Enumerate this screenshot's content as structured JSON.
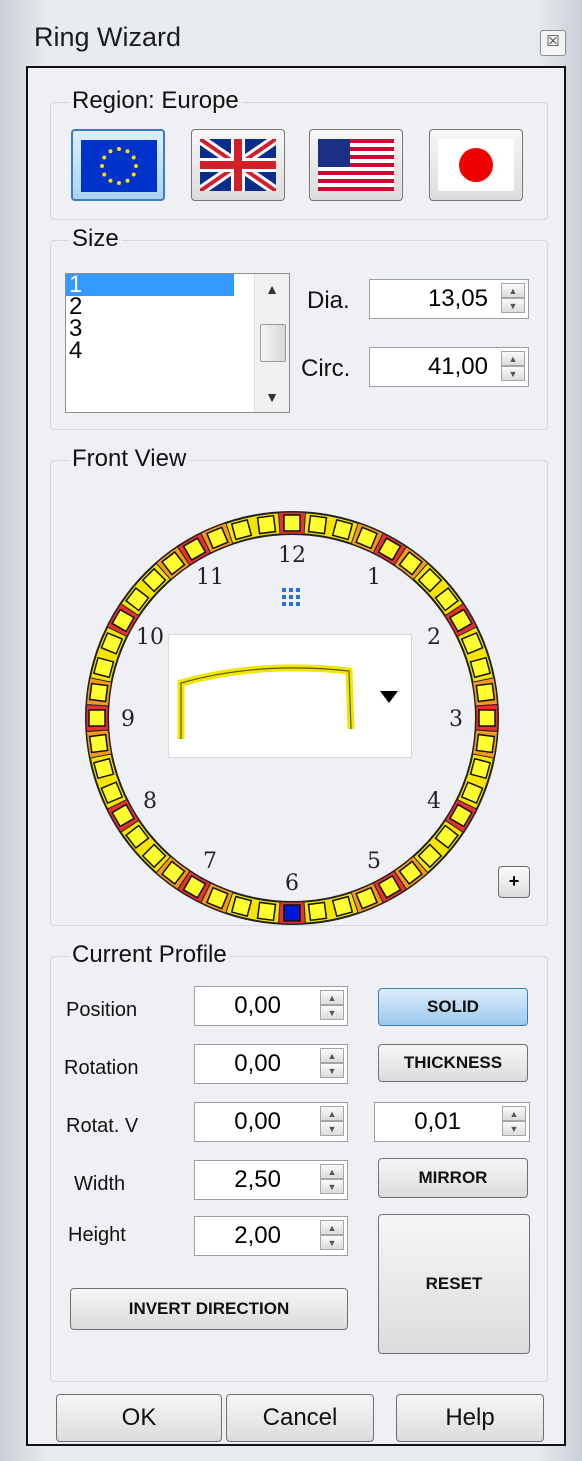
{
  "window": {
    "title": "Ring Wizard",
    "close_glyph": "☒"
  },
  "region": {
    "label": "Region: Europe",
    "flags": [
      {
        "name": "eu-flag-icon",
        "selected": true
      },
      {
        "name": "uk-flag-icon",
        "selected": false
      },
      {
        "name": "us-flag-icon",
        "selected": false
      },
      {
        "name": "japan-flag-icon",
        "selected": false
      }
    ]
  },
  "size": {
    "label": "Size",
    "list_items": [
      "1",
      "2",
      "3",
      "4"
    ],
    "selected_item": "1",
    "dia_label": "Dia.",
    "dia_value": "13,05",
    "circ_label": "Circ.",
    "circ_value": "41,00"
  },
  "front_view": {
    "label": "Front View",
    "clock_numbers": [
      "12",
      "1",
      "2",
      "3",
      "4",
      "5",
      "6",
      "7",
      "8",
      "9",
      "10",
      "11"
    ],
    "plus_label": "+",
    "colors": {
      "ring_yellow": "#f4e400",
      "stone_red": "#e83030",
      "stone_orange": "#f39a1c",
      "selected_blue": "#0018d8",
      "center_dots": "#2a6fd6"
    }
  },
  "profile": {
    "label": "Current Profile",
    "position_label": "Position",
    "position_value": "0,00",
    "rotation_label": "Rotation",
    "rotation_value": "0,00",
    "rotatv_label": "Rotat. V",
    "rotatv_value": "0,00",
    "width_label": "Width",
    "width_value": "2,50",
    "height_label": "Height",
    "height_value": "2,00",
    "thickness_value": "0,01",
    "solid_label": "SOLID",
    "thickness_label": "THICKNESS",
    "mirror_label": "MIRROR",
    "reset_label": "RESET",
    "invert_label": "INVERT DIRECTION"
  },
  "footer": {
    "ok_label": "OK",
    "cancel_label": "Cancel",
    "help_label": "Help"
  }
}
